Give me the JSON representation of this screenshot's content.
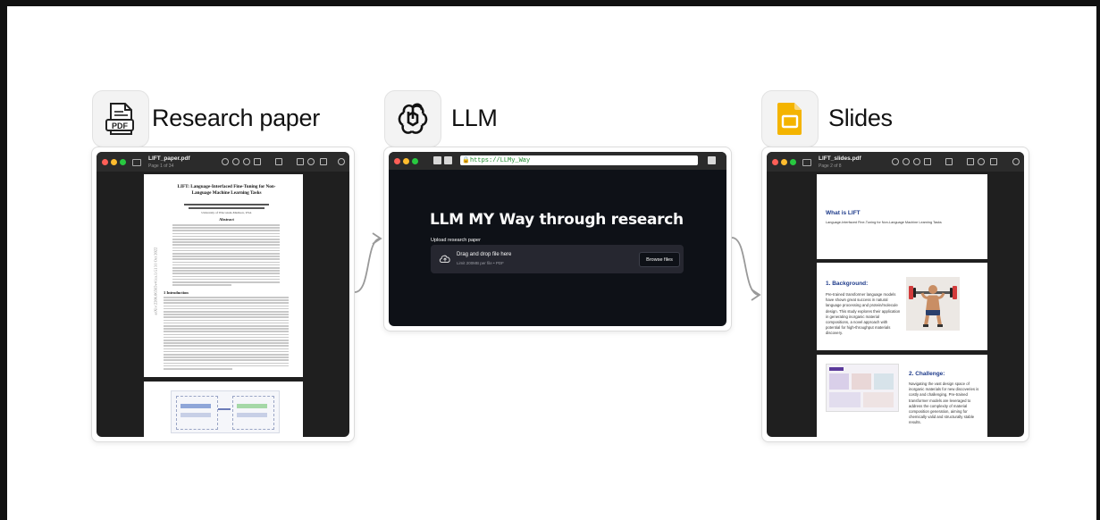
{
  "steps": [
    {
      "label": "Research paper",
      "icon": "pdf-file-icon"
    },
    {
      "label": "LLM",
      "icon": "openai-logo-icon"
    },
    {
      "label": "Slides",
      "icon": "google-slides-icon"
    }
  ],
  "pdf_viewer": {
    "file_name": "LIFT_paper.pdf",
    "page_info": "Page 1 of 34",
    "paper_title": "LIFT: Language-Interfaced Fine-Tuning for Non-Language Machine Learning Tasks",
    "affiliation": "University of Wisconsin-Madison, USA",
    "abstract_heading": "Abstract",
    "intro_heading": "1   Introduction",
    "arxiv_stamp": "arXiv:2206.06565v4  [cs.LG]  31 Oct 2022"
  },
  "app": {
    "url": "https://LLMy_Way",
    "heading": "LLM MY Way through research",
    "upload_label": "Upload research paper",
    "dropzone_title": "Drag and drop file here",
    "dropzone_hint": "Limit 200MB per file • PDF",
    "browse_button": "Browse files"
  },
  "slides_viewer": {
    "file_name": "LIFT_slides.pdf",
    "page_info": "Page 2 of 8",
    "slides": [
      {
        "title": "What is LIFT",
        "body": "Language-Interfaced Fine-Tuning for Non-Language Machine Learning Tasks"
      },
      {
        "title": "1. Background:",
        "body": "Pre-trained transformer language models have shown great success in natural language processing and protein/molecule design. This study explores their application in generating inorganic material compositions, a novel approach with potential for high-throughput materials discovery."
      },
      {
        "title": "2. Challenge:",
        "body": "Navigating the vast design space of inorganic materials for new discoveries is costly and challenging. Pre-trained transformer models are leveraged to address the complexity of material composition generation, aiming for chemically valid and structurally stable results."
      }
    ]
  },
  "colors": {
    "dark_window": "#2b2b2b",
    "app_bg": "#0e1117",
    "slide_title": "#1d3a8a",
    "slides_yellow": "#f4b400"
  }
}
